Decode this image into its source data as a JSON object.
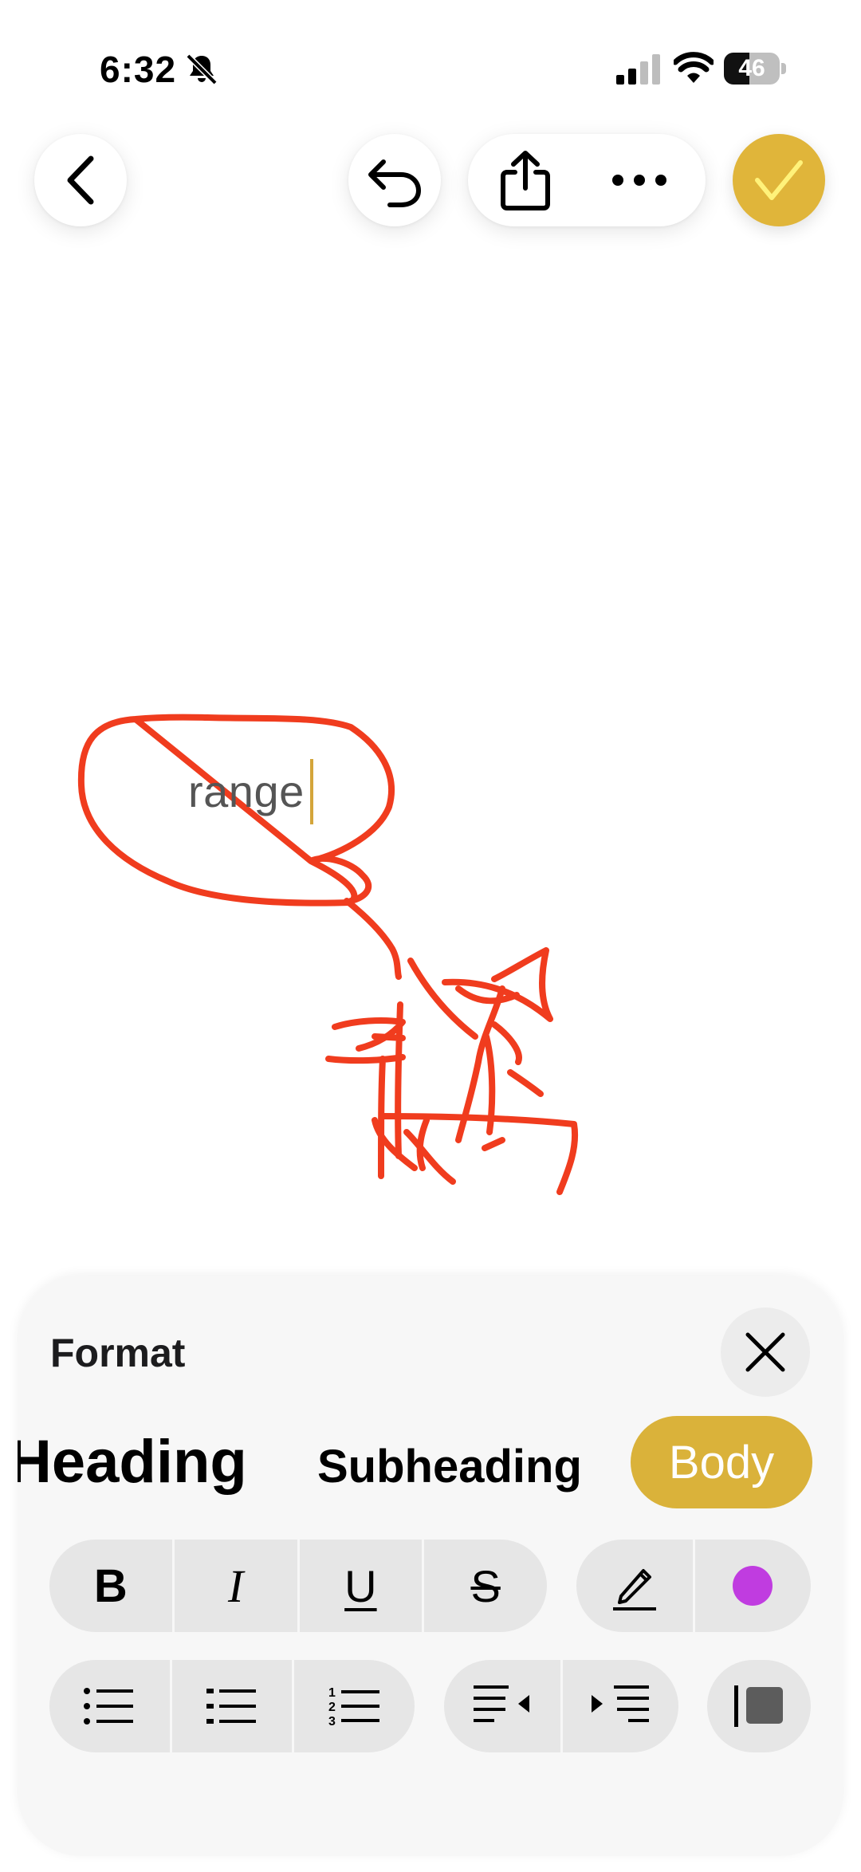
{
  "status_bar": {
    "time": "6:32",
    "battery": "46",
    "battery_level": 0.46,
    "icons": [
      "bell-slash-icon",
      "cellular-signal-icon",
      "wifi-icon",
      "battery-icon"
    ]
  },
  "toolbar": {
    "buttons": [
      "chevron-left-icon",
      "undo-icon",
      "share-icon",
      "more-icon",
      "checkmark-icon"
    ]
  },
  "note": {
    "text": "range",
    "ink_color": "#f03c1e"
  },
  "format_panel": {
    "title": "Format",
    "styles": [
      "Heading",
      "Subheading",
      "Body"
    ],
    "selected_style": "Body",
    "text_formats": [
      "B",
      "I",
      "U",
      "S"
    ],
    "highlight_color": "#c03ce0",
    "list_buttons": [
      "bulleted-list-icon",
      "dashed-list-icon",
      "numbered-list-icon"
    ],
    "indent_buttons": [
      "decrease-indent-icon",
      "increase-indent-icon"
    ],
    "block_quote": "block-quote-icon"
  },
  "colors": {
    "accent": "#dab23a",
    "panel_bg": "#f7f7f7",
    "segment_bg": "#e6e6e6"
  }
}
